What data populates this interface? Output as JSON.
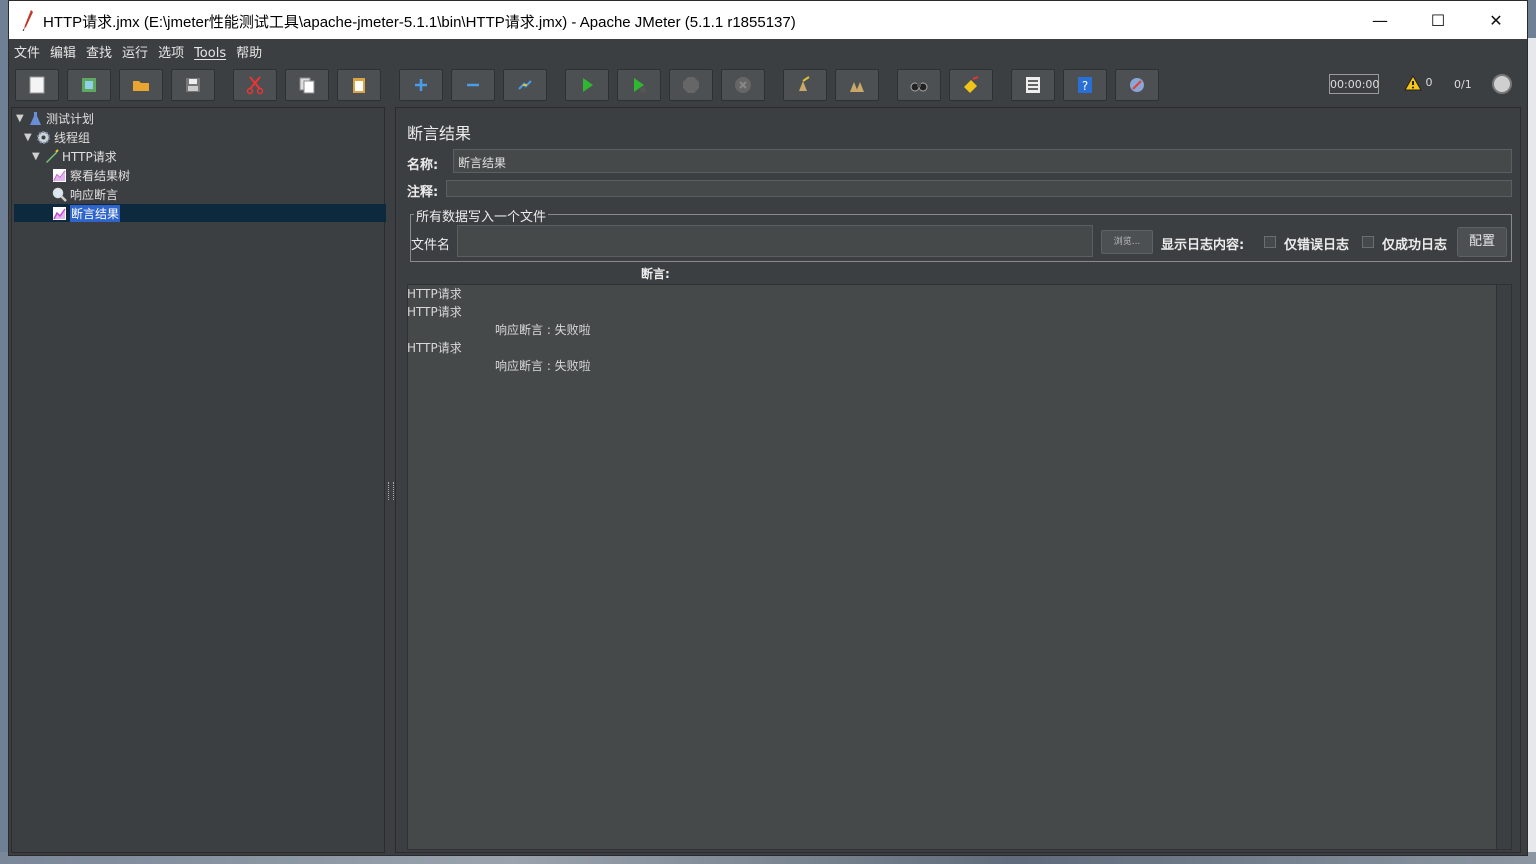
{
  "window": {
    "title": "HTTP请求.jmx (E:\\jmeter性能测试工具\\apache-jmeter-5.1.1\\bin\\HTTP请求.jmx) - Apache JMeter (5.1.1 r1855137)",
    "controls": {
      "minimize": "—",
      "maximize": "☐",
      "close": "✕"
    }
  },
  "menu": [
    "文件",
    "编辑",
    "查找",
    "运行",
    "选项",
    "Tools",
    "帮助"
  ],
  "toolbar": {
    "buttons": [
      "new-icon",
      "templates-icon",
      "open-icon",
      "save-icon",
      "cut-icon",
      "copy-icon",
      "paste-icon",
      "expand-icon",
      "collapse-icon",
      "toggle-icon",
      "start-icon",
      "start-no-pause-icon",
      "stop-icon",
      "shutdown-icon",
      "clear-icon",
      "clear-all-icon",
      "search-icon",
      "reset-search-icon",
      "function-helper-icon",
      "help-icon",
      "remote-icon"
    ],
    "timer": "00:00:00",
    "warnings": "0",
    "threads": "0/1"
  },
  "tree": [
    {
      "label": "测试计划",
      "icon": "flask-icon",
      "level": 0,
      "toggle": "▼"
    },
    {
      "label": "线程组",
      "icon": "gear-icon",
      "level": 1,
      "toggle": "▼"
    },
    {
      "label": "HTTP请求",
      "icon": "pen-icon",
      "level": 2,
      "toggle": "▼"
    },
    {
      "label": "察看结果树",
      "icon": "chart-icon",
      "level": 3,
      "toggle": ""
    },
    {
      "label": "响应断言",
      "icon": "magnifier-icon",
      "level": 3,
      "toggle": ""
    },
    {
      "label": "断言结果",
      "icon": "chart-icon",
      "level": 3,
      "toggle": "",
      "selected": true
    }
  ],
  "panel": {
    "title": "断言结果",
    "name_label": "名称:",
    "name_value": "断言结果",
    "comment_label": "注释:",
    "comment_value": "",
    "file_group_title": "所有数据写入一个文件",
    "filename_label": "文件名",
    "filename_value": "",
    "browse_label": "浏览...",
    "log_label": "显示日志内容:",
    "errors_only_label": "仅错误日志",
    "success_only_label": "仅成功日志",
    "configure_label": "配置",
    "assertion_header": "断言:",
    "results": [
      {
        "text": "HTTP请求",
        "indent": false
      },
      {
        "text": "HTTP请求",
        "indent": false
      },
      {
        "text": "响应断言 : 失败啦",
        "indent": true
      },
      {
        "text": "HTTP请求",
        "indent": false
      },
      {
        "text": "响应断言 : 失败啦",
        "indent": true
      }
    ]
  }
}
